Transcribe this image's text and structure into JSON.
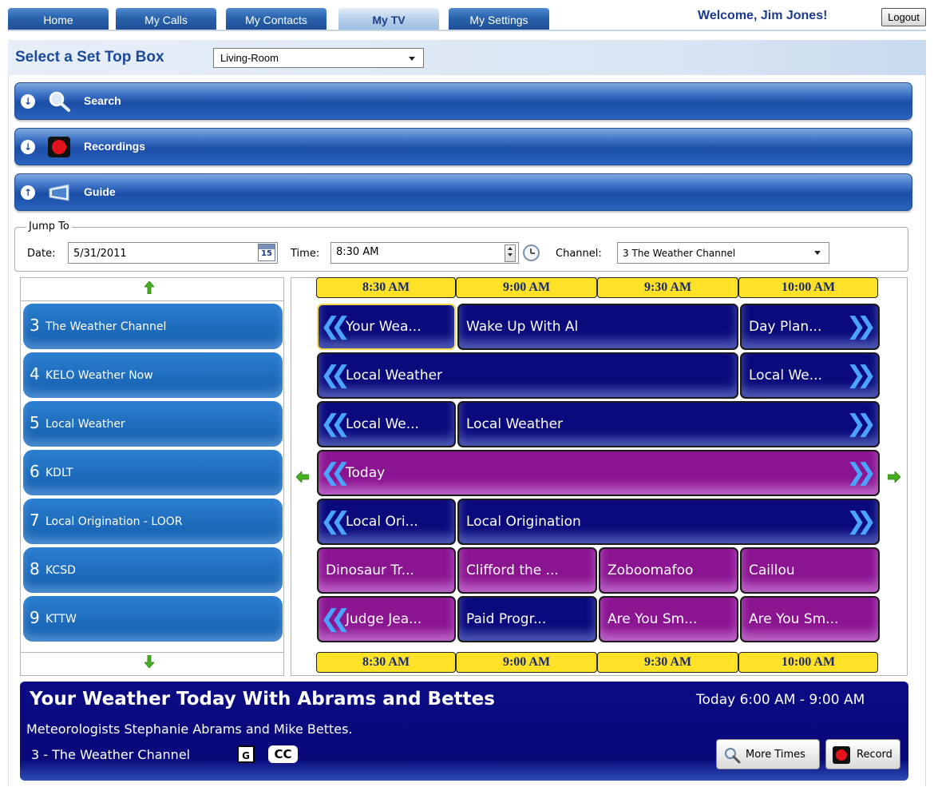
{
  "nav": {
    "tabs": [
      {
        "label": "Home"
      },
      {
        "label": "My Calls"
      },
      {
        "label": "My Contacts"
      },
      {
        "label": "My TV",
        "active": true
      },
      {
        "label": "My Settings"
      }
    ],
    "welcome": "Welcome, Jim Jones!",
    "logout": "Logout"
  },
  "set_top_box": {
    "title": "Select a Set Top Box",
    "selected": "Living-Room"
  },
  "accordion": [
    {
      "label": "Search",
      "icon": "search-icon",
      "expanded": false
    },
    {
      "label": "Recordings",
      "icon": "record-icon",
      "expanded": false
    },
    {
      "label": "Guide",
      "icon": "tv-icon",
      "expanded": true
    }
  ],
  "jump_to": {
    "legend": "Jump To",
    "date_label": "Date:",
    "date_value": "5/31/2011",
    "calendar_day": "15",
    "time_label": "Time:",
    "time_value": "8:30 AM",
    "channel_label": "Channel:",
    "channel_value": "3  The Weather Channel"
  },
  "guide": {
    "times": [
      "8:30 AM",
      "9:00 AM",
      "9:30 AM",
      "10:00 AM"
    ],
    "channels": [
      {
        "number": "3",
        "name": "The Weather Channel"
      },
      {
        "number": "4",
        "name": "KELO Weather Now"
      },
      {
        "number": "5",
        "name": "Local Weather"
      },
      {
        "number": "6",
        "name": "KDLT"
      },
      {
        "number": "7",
        "name": "Local Origination - LOOR"
      },
      {
        "number": "8",
        "name": "KCSD"
      },
      {
        "number": "9",
        "name": "KTTW"
      }
    ],
    "rows": [
      [
        {
          "title": "Your Wea...",
          "color": "blue",
          "selected": true,
          "continues_before": true
        },
        {
          "title": "Wake Up With Al",
          "color": "blue"
        },
        {
          "title": "Day Plan...",
          "color": "blue",
          "continues_after": true
        }
      ],
      [
        {
          "title": "Local Weather",
          "color": "blue",
          "continues_before": true
        },
        {
          "title": "Local We...",
          "color": "blue",
          "continues_after": true
        }
      ],
      [
        {
          "title": "Local We...",
          "color": "blue",
          "continues_before": true
        },
        {
          "title": "Local Weather",
          "color": "blue",
          "continues_after": true
        }
      ],
      [
        {
          "title": "Today",
          "color": "purple",
          "continues_before": true,
          "continues_after": true
        }
      ],
      [
        {
          "title": "Local Ori...",
          "color": "blue",
          "continues_before": true
        },
        {
          "title": "Local Origination",
          "color": "blue",
          "continues_after": true
        }
      ],
      [
        {
          "title": "Dinosaur Tr...",
          "color": "purple"
        },
        {
          "title": "Clifford the ...",
          "color": "purple"
        },
        {
          "title": "Zoboomafoo",
          "color": "purple"
        },
        {
          "title": "Caillou",
          "color": "purple"
        }
      ],
      [
        {
          "title": "Judge Jea...",
          "color": "purple",
          "continues_before": true
        },
        {
          "title": "Paid Progr...",
          "color": "blue"
        },
        {
          "title": "Are You Sm...",
          "color": "purple"
        },
        {
          "title": "Are You Sm...",
          "color": "purple"
        }
      ]
    ]
  },
  "detail": {
    "title": "Your Weather Today With Abrams and Bettes",
    "time": "Today 6:00 AM - 9:00 AM",
    "description": "Meteorologists Stephanie Abrams and Mike Bettes.",
    "channel": "3 - The Weather Channel",
    "rating": "G",
    "cc": "CC",
    "more_times": "More Times",
    "record": "Record"
  },
  "colors": {
    "program_blue": "#0a0a7c",
    "program_purple": "#8b1491",
    "time_header": "#ffe227",
    "channel_button": "#1e6cbc"
  }
}
